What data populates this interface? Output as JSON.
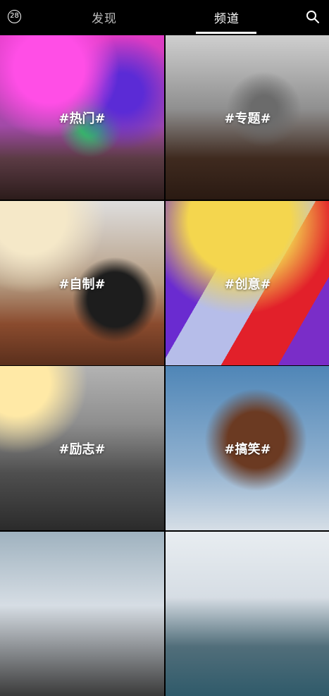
{
  "topbar": {
    "badge_count": "28",
    "tabs": [
      {
        "label": "发现",
        "active": false
      },
      {
        "label": "频道",
        "active": true
      }
    ]
  },
  "channels": [
    {
      "label": "#热门#"
    },
    {
      "label": "#专题#"
    },
    {
      "label": "#自制#"
    },
    {
      "label": "#创意#"
    },
    {
      "label": "#励志#"
    },
    {
      "label": "#搞笑#"
    },
    {
      "label": ""
    },
    {
      "label": ""
    }
  ],
  "colors": {
    "background": "#000000",
    "active_tab": "#ffffff",
    "inactive_tab": "#bdbdbd"
  },
  "icons": {
    "badge": "count-badge",
    "search": "search-icon"
  }
}
